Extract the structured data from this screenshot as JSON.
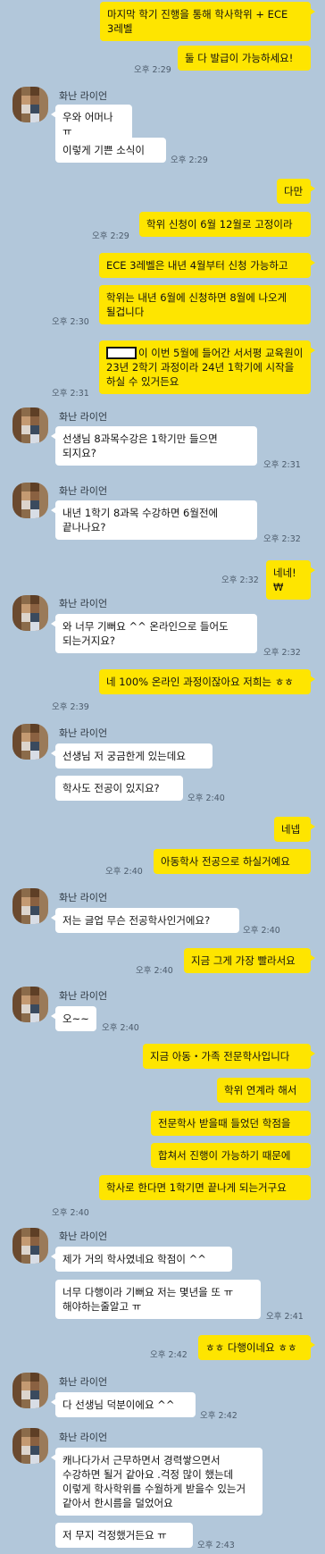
{
  "sender": {
    "name": "화난 라이언"
  },
  "messages": [
    {
      "from": "me",
      "text": "마지막 학기 진행을 통해 학사학위 + ECE 3레벨"
    },
    {
      "from": "me",
      "text": "둘 다 발급이 가능하세요!",
      "time": "오후 2:29"
    },
    {
      "from": "other",
      "text": "우와 어머나 ㅠ"
    },
    {
      "from": "other",
      "text": "이렇게 기쁜 소식이",
      "time": "오후 2:29"
    },
    {
      "from": "me",
      "text": "다만"
    },
    {
      "from": "me",
      "text": "학위 신청이 6월 12월로 고정이라",
      "time": "오후 2:29"
    },
    {
      "from": "me",
      "text": "ECE 3레벨은 내년 4월부터 신청 가능하고"
    },
    {
      "from": "me",
      "text": "학위는 내년 6월에 신청하면 8월에 나오게 될겁니다",
      "time": "오후 2:30"
    },
    {
      "from": "me",
      "text": "이 이번 5월에 들어간 서서평 교육원이 23년 2학기 과정이라 24년 1학기에 시작을 하실 수 있거든요",
      "time": "오후 2:31",
      "redacted_prefix": true
    },
    {
      "from": "other",
      "text": "선생님 8과목수강은 1학기만 들으면 되지요?",
      "time": "오후 2:31"
    },
    {
      "from": "other",
      "text": "내년 1학기 8과목 수강하면 6월전에 끝나나요?",
      "time": "오후 2:32"
    },
    {
      "from": "me",
      "text": "네네!₩",
      "time": "오후 2:32"
    },
    {
      "from": "other",
      "text": "와 너무 기뻐요 ^^ 온라인으로 들어도 되는거지요?",
      "time": "오후 2:32"
    },
    {
      "from": "me",
      "text": "네 100% 온라인 과정이잖아요 저희는 ㅎㅎ",
      "time": "오후 2:39"
    },
    {
      "from": "other",
      "text": "선생님 저 궁금한게 있는데요"
    },
    {
      "from": "other",
      "text": "학사도 전공이 있지요?",
      "time": "오후 2:40"
    },
    {
      "from": "me",
      "text": "네넵"
    },
    {
      "from": "me",
      "text": "아동학사 전공으로 하실거예요",
      "time": "오후 2:40"
    },
    {
      "from": "other",
      "text": "저는 글업 무슨 전공학사인거에요?",
      "time": "오후 2:40"
    },
    {
      "from": "me",
      "text": "지금 그게 가장 빨라서요",
      "time": "오후 2:40"
    },
    {
      "from": "other",
      "text": "오~~",
      "time": "오후 2:40"
    },
    {
      "from": "me",
      "text": "지금 아동・가족 전문학사입니다"
    },
    {
      "from": "me",
      "text": "학위 연계라 해서"
    },
    {
      "from": "me",
      "text": "전문학사 받을때 들었던 학점을"
    },
    {
      "from": "me",
      "text": "합쳐서 진행이 가능하기 때문에"
    },
    {
      "from": "me",
      "text": "학사로 한다면 1학기면 끝나게 되는거구요",
      "time": "오후 2:40"
    },
    {
      "from": "other",
      "text": "제가 거의 학사였네요 학점이 ^^"
    },
    {
      "from": "other",
      "text": "너무 다행이라 기뻐요 저는 몇년을 또 ㅠ 해야하는줄알고 ㅠ",
      "time": "오후 2:41"
    },
    {
      "from": "me",
      "text": "ㅎㅎ 다행이네요 ㅎㅎ",
      "time": "오후 2:42"
    },
    {
      "from": "other",
      "text": "다 선생님 덕분이에요 ^^",
      "time": "오후 2:42"
    },
    {
      "from": "other",
      "text": "캐나다가서 근무하면서 경력쌓으면서 수강하면 될거 같아요 .걱정 많이 했는데 이렇게 학사학위를 수월하게 받을수 있는거 같아서 한시름을 덜었어요"
    },
    {
      "from": "other",
      "text": "저 무지 걱정했거든요 ㅠ",
      "time": "오후 2:43"
    }
  ],
  "colors": {
    "background": "#b2c7da",
    "my_bubble": "#fee500",
    "other_bubble": "#ffffff"
  }
}
